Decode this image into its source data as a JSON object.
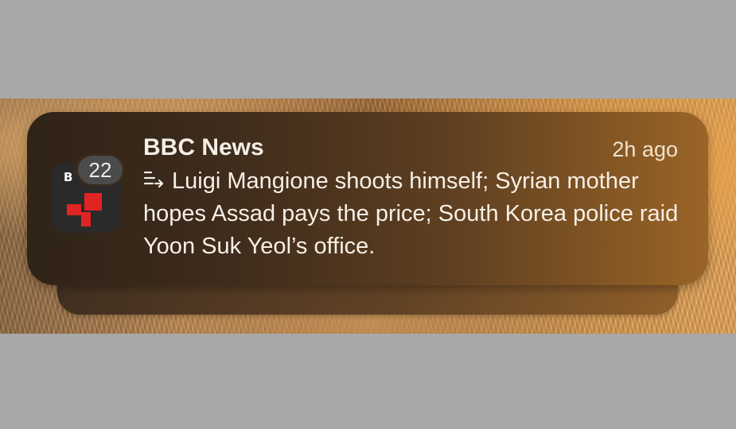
{
  "notification": {
    "app_name": "BBC News",
    "time": "2h ago",
    "badge_count": "22",
    "icon_logo_text": "B",
    "body": "Luigi Mangione shoots himself; Syrian mother hopes Assad pays the price; South Korea police raid Yoon Suk Yeol’s office.",
    "summary_icon": "summary-lines-icon"
  },
  "colors": {
    "background": "#a8a8a8",
    "notification_start": "#2f2317",
    "notification_end": "#9a6426",
    "bbc_red": "#e02424"
  }
}
